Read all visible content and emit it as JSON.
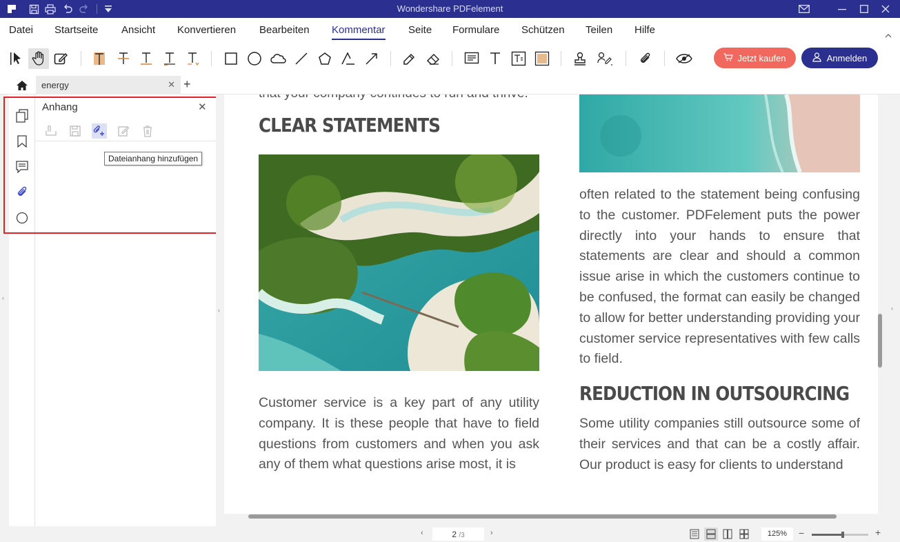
{
  "window": {
    "title": "Wondershare PDFelement"
  },
  "menu": {
    "items": [
      "Datei",
      "Startseite",
      "Ansicht",
      "Konvertieren",
      "Bearbeiten",
      "Kommentar",
      "Seite",
      "Formulare",
      "Schützen",
      "Teilen",
      "Hilfe"
    ],
    "active": "Kommentar"
  },
  "toolbar": {
    "buy_label": "Jetzt kaufen",
    "login_label": "Anmelden",
    "buy_color": "#f0685e",
    "brand_color": "#2b2f8f",
    "tools": [
      "select-icon",
      "hand-icon",
      "edit-icon",
      "highlight-icon",
      "strikethrough-icon",
      "underline-icon",
      "squiggly-icon",
      "insert-text-icon",
      "rectangle-icon",
      "oval-icon",
      "cloud-icon",
      "line-icon",
      "polygon-icon",
      "polyline-icon",
      "arrow-icon",
      "pencil-icon",
      "eraser-icon",
      "note-icon",
      "typewriter-icon",
      "textbox-icon",
      "area-highlight-icon",
      "stamp-icon",
      "signature-icon",
      "attachment-icon",
      "hide-annotations-icon"
    ]
  },
  "tabs": {
    "document_name": "energy"
  },
  "panel": {
    "title": "Anhang",
    "tooltip": "Dateianhang hinzufügen",
    "tools": [
      "open-attachment-icon",
      "save-attachment-icon",
      "add-attachment-icon",
      "edit-attachment-icon",
      "delete-attachment-icon"
    ],
    "highlight_color": "#e02424"
  },
  "document": {
    "partial_top_line": "that your company continues to run and thrive.",
    "heading_left": "CLEAR STATEMENTS",
    "para_left": "Customer service is a key part of any utility company. It is these people that have to field questions from customers and when you ask any of them what questions arise most, it is",
    "para_right_top": "often related to the statement being confusing to the customer. PDFelement puts the power directly into your hands to ensure that statements are clear and should a common issue arise in which the customers continue to be confused, the format can easily be changed to allow for better understanding providing your customer service representatives with few calls to field.",
    "heading_right": "REDUCTION IN OUTSOURCING",
    "para_right_bottom": "Some utility companies still outsource some of their services and that can be a costly affair. Our product is easy for clients to understand",
    "image_left": "aerial-island-photo",
    "image_right": "aerial-beach-photo"
  },
  "status": {
    "current_page": "2",
    "total_pages": "/3",
    "zoom": "125%",
    "zoom_fraction": 0.55
  }
}
